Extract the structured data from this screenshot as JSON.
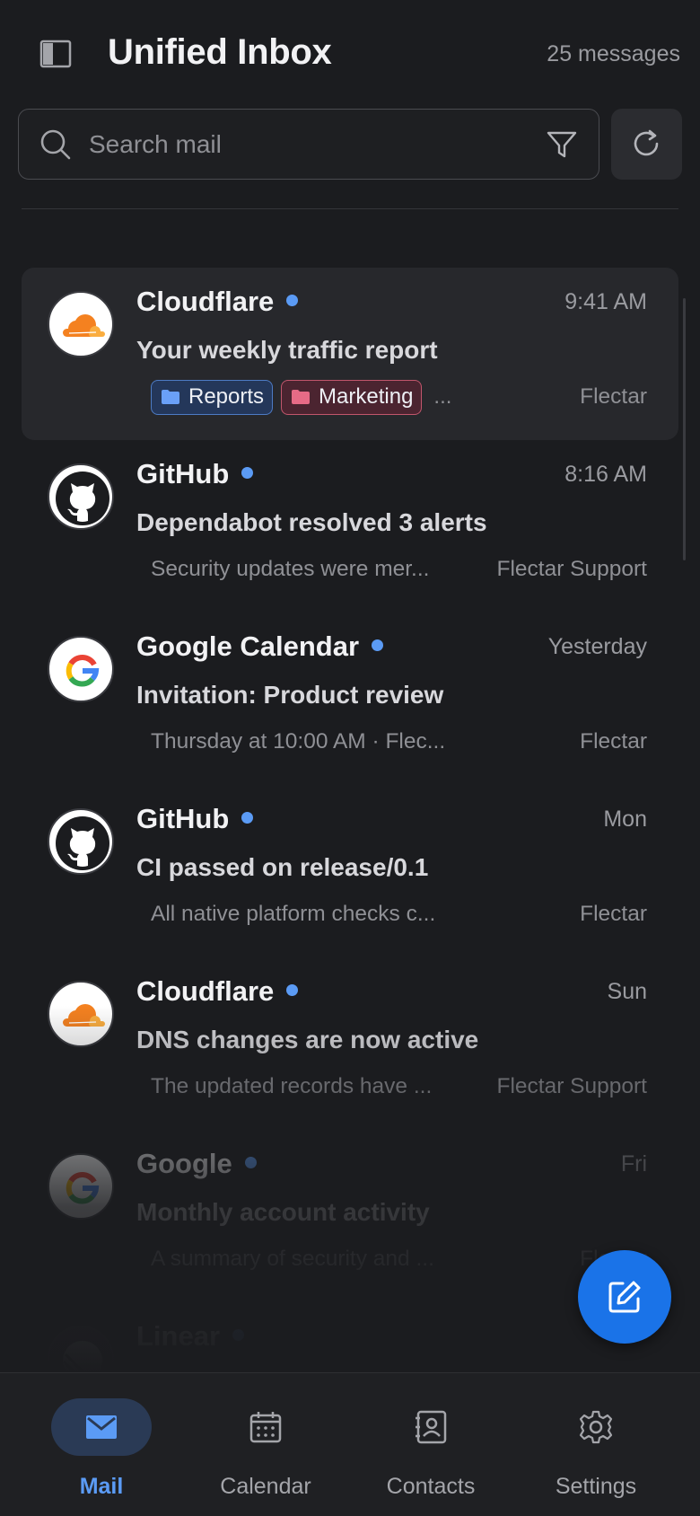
{
  "header": {
    "title": "Unified Inbox",
    "count": "25 messages"
  },
  "search": {
    "placeholder": "Search mail",
    "value": ""
  },
  "messages": [
    {
      "sender": "Cloudflare",
      "avatar": "cloudflare-logo",
      "time": "9:41 AM",
      "subject": "Your weekly traffic report",
      "preview": "",
      "tags": [
        "Reports",
        "Marketing"
      ],
      "more": "...",
      "account": "Flectar",
      "unread": true,
      "selected": true
    },
    {
      "sender": "GitHub",
      "avatar": "github-logo",
      "time": "8:16 AM",
      "subject": "Dependabot resolved 3 alerts",
      "preview": "Security updates were mer...",
      "account": "Flectar Support",
      "unread": true
    },
    {
      "sender": "Google Calendar",
      "avatar": "google-logo",
      "time": "Yesterday",
      "subject": "Invitation: Product review",
      "preview": "Thursday at 10:00 AM · Flec...",
      "account": "Flectar",
      "unread": true
    },
    {
      "sender": "GitHub",
      "avatar": "github-logo",
      "time": "Mon",
      "subject": "CI passed on release/0.1",
      "preview": "All native platform checks c...",
      "account": "Flectar",
      "unread": true
    },
    {
      "sender": "Cloudflare",
      "avatar": "cloudflare-logo",
      "time": "Sun",
      "subject": "DNS changes are now active",
      "preview": "The updated records have ...",
      "account": "Flectar Support",
      "unread": true
    },
    {
      "sender": "Google",
      "avatar": "google-logo",
      "time": "Fri",
      "subject": "Monthly account activity",
      "preview": "A summary of security and ...",
      "account": "Flectar",
      "unread": true
    },
    {
      "sender": "Linear",
      "avatar": "linear-logo",
      "time": "",
      "subject": "",
      "preview": "",
      "account": "",
      "unread": true
    }
  ],
  "nav": {
    "mail": "Mail",
    "calendar": "Calendar",
    "contacts": "Contacts",
    "settings": "Settings",
    "active": "mail"
  },
  "colors": {
    "accent": "#5b9bf5",
    "fab": "#1a73e8",
    "background": "#1b1c1f"
  }
}
